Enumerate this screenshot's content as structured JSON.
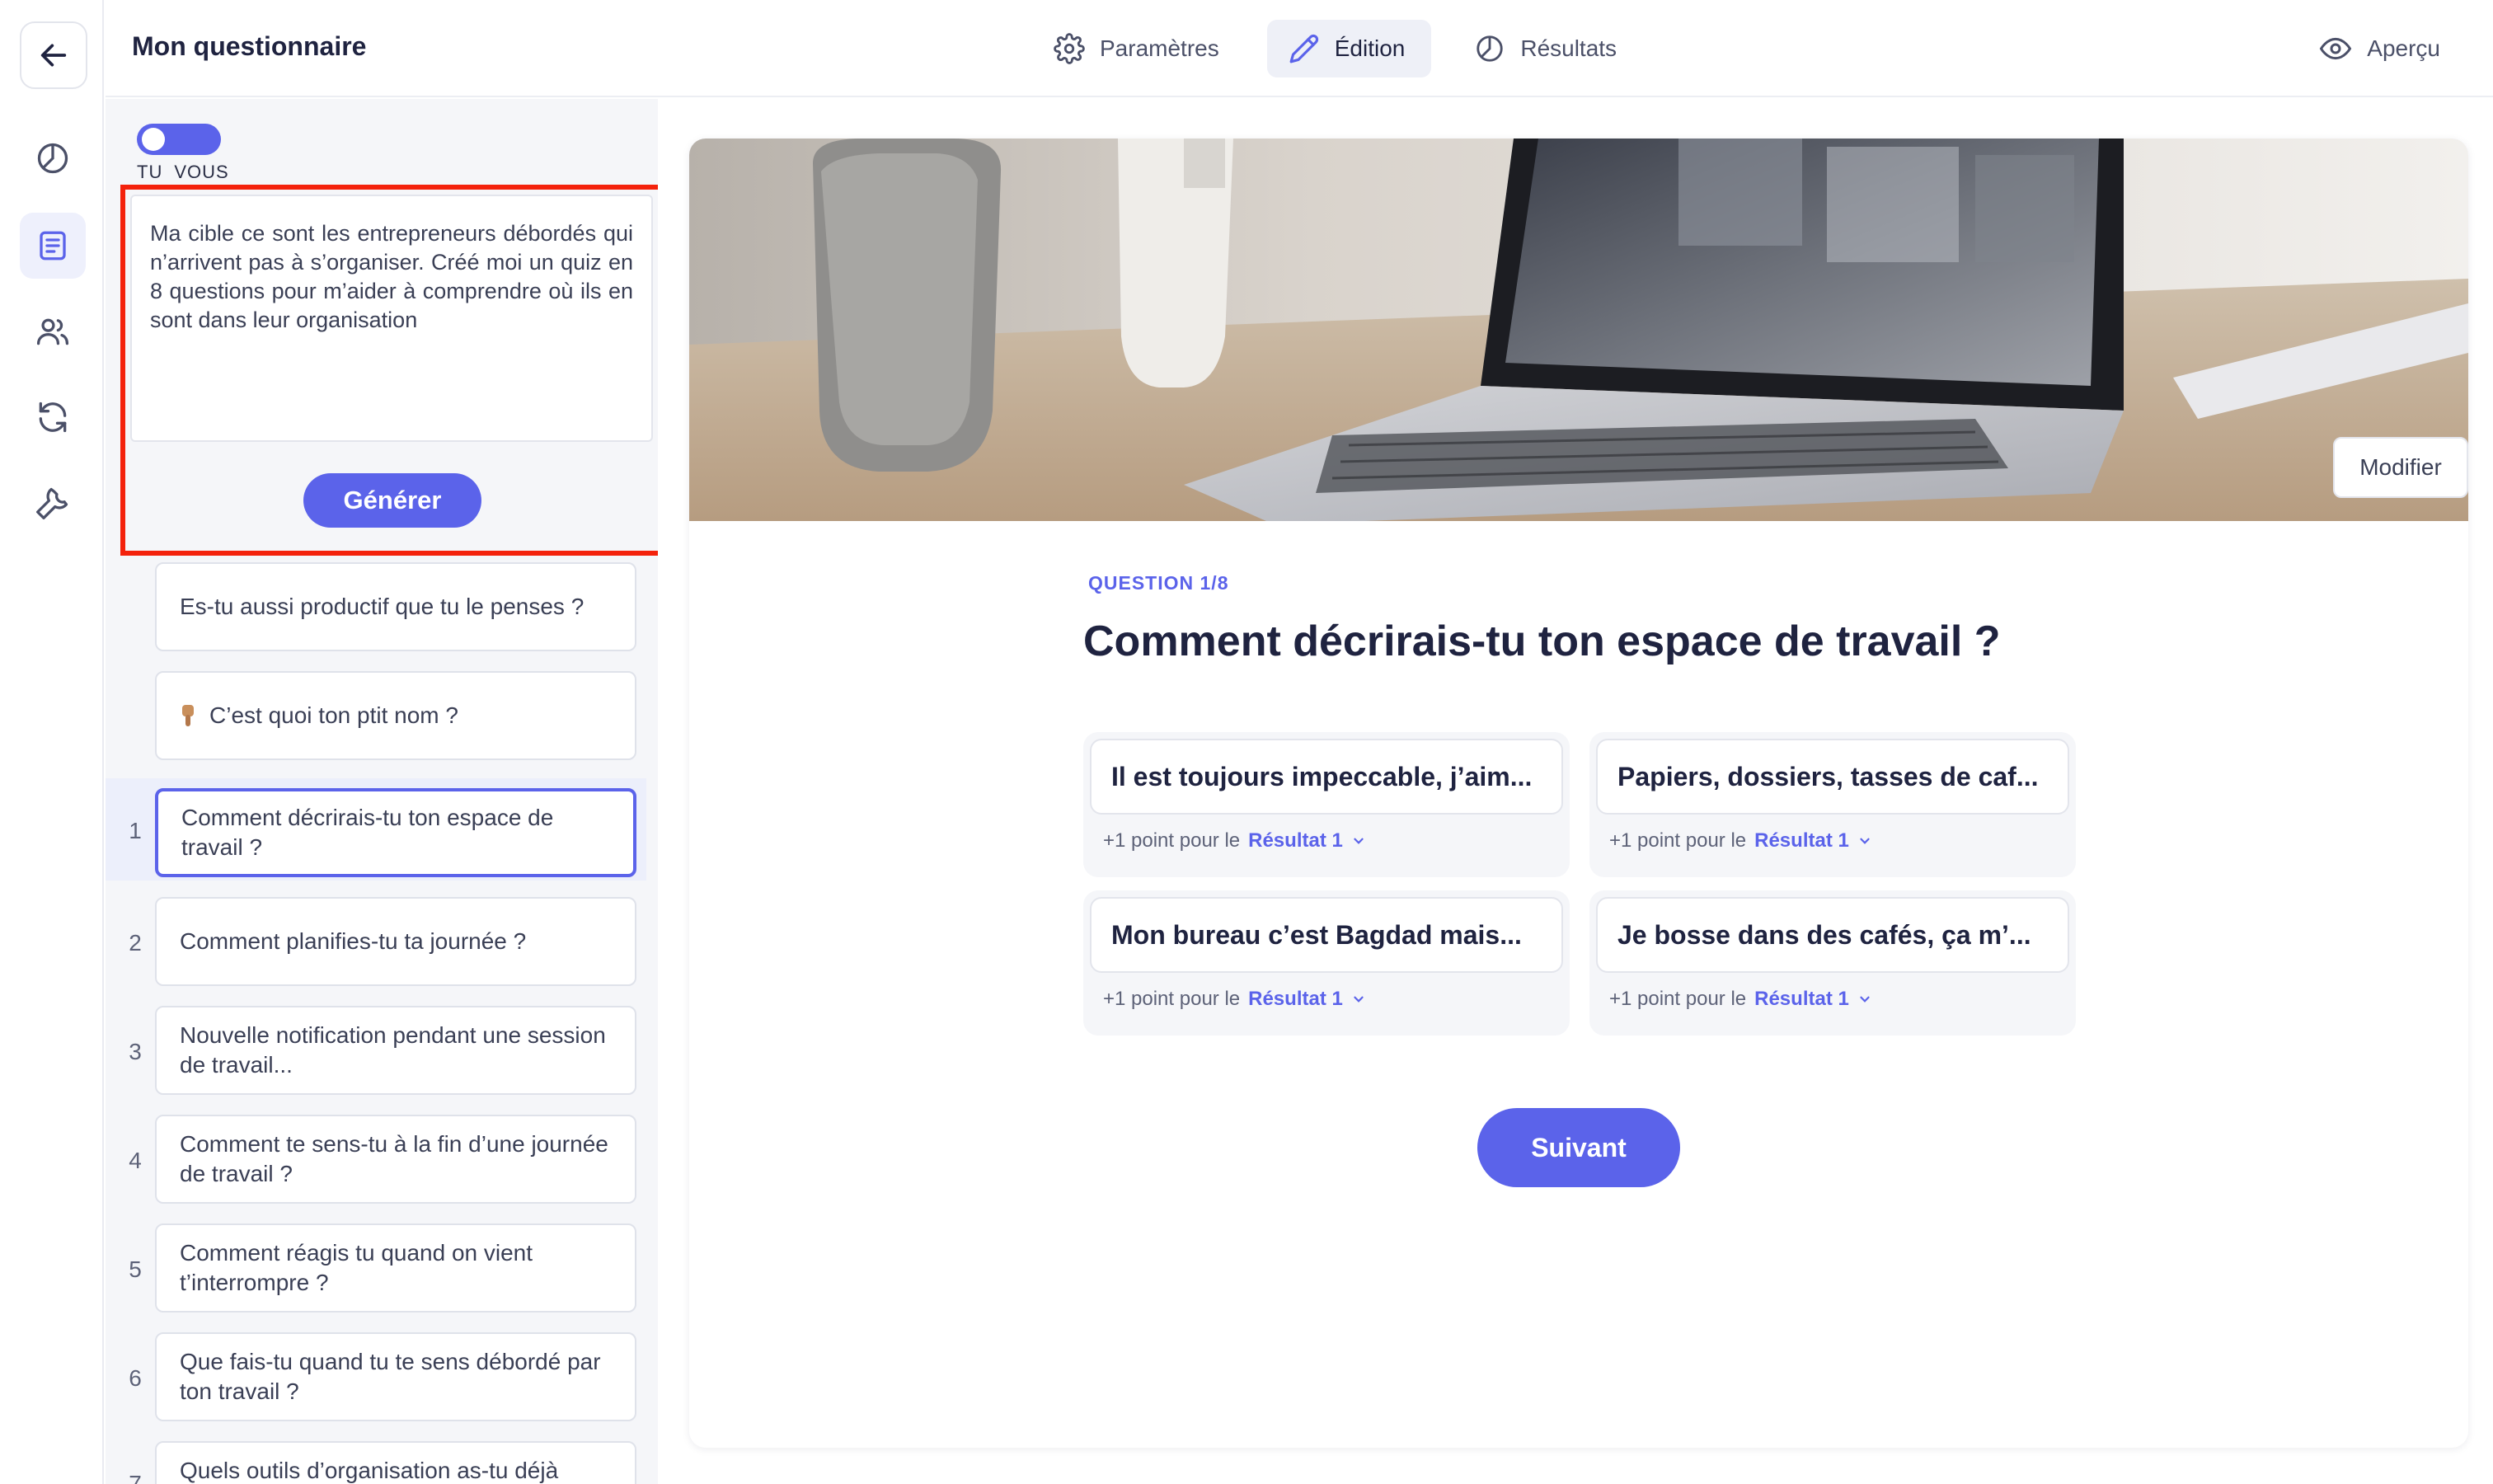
{
  "header": {
    "title": "Mon questionnaire",
    "tabs": [
      {
        "label": "Paramètres",
        "icon": "gear-icon"
      },
      {
        "label": "Édition",
        "icon": "pencil-icon",
        "active": true
      },
      {
        "label": "Résultats",
        "icon": "chart-icon"
      }
    ],
    "preview_label": "Aperçu"
  },
  "rail": {
    "items": [
      "back-arrow-icon",
      "chart-icon",
      "document-icon",
      "users-icon",
      "refresh-icon",
      "wrench-icon"
    ],
    "active": "document-icon"
  },
  "panel": {
    "toggle": {
      "left_label": "TU",
      "right_label": "VOUS"
    },
    "prompt_text": "Ma cible ce sont les entrepreneurs débordés qui n’arrivent pas à s’organiser. Créé moi un quiz en 8 questions pour m’aider à comprendre où ils en sont dans leur organisation",
    "generate_label": "Générer",
    "intro_cards": [
      "Es-tu aussi productif que tu le penses ?",
      "C’est quoi ton ptit nom ?"
    ],
    "questions": [
      {
        "num": "1",
        "text": "Comment décrirais-tu ton espace de travail ?"
      },
      {
        "num": "2",
        "text": "Comment planifies-tu ta journée ?"
      },
      {
        "num": "3",
        "text": "Nouvelle notification pendant une session de travail..."
      },
      {
        "num": "4",
        "text": "Comment te sens-tu à la fin d’une journée de travail ?"
      },
      {
        "num": "5",
        "text": "Comment réagis tu quand on vient t’interrompre ?"
      },
      {
        "num": "6",
        "text": "Que fais-tu quand tu te sens débordé par ton travail ?"
      },
      {
        "num": "7",
        "text": "Quels outils d’organisation as-tu déjà"
      }
    ]
  },
  "main": {
    "modify_label": "Modifier",
    "question_label": "QUESTION 1/8",
    "question_title": "Comment décrirais-tu ton espace de travail ?",
    "answers": [
      {
        "text": "Il est toujours impeccable, j’aim...",
        "points_prefix": "+1 point pour le",
        "result": "Résultat 1"
      },
      {
        "text": "Papiers, dossiers, tasses de caf...",
        "points_prefix": "+1 point pour le",
        "result": "Résultat 1"
      },
      {
        "text": "Mon bureau c’est Bagdad mais...",
        "points_prefix": "+1 point pour le",
        "result": "Résultat 1"
      },
      {
        "text": "Je bosse dans des cafés, ça m’...",
        "points_prefix": "+1 point pour le",
        "result": "Résultat 1"
      }
    ],
    "next_label": "Suivant"
  },
  "colors": {
    "accent": "#5b63ea",
    "highlight_border": "#f4220c",
    "text_dark": "#1f2340"
  }
}
